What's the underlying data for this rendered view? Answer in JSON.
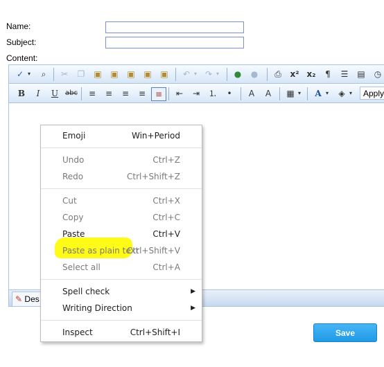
{
  "form": {
    "name_label": "Name:",
    "subject_label": "Subject:",
    "content_label": "Content:",
    "name_value": "",
    "subject_value": ""
  },
  "toolbar": {
    "apply_label": "Apply"
  },
  "design_tab": {
    "label": "Des"
  },
  "context_menu": {
    "emoji": {
      "label": "Emoji",
      "shortcut": "Win+Period"
    },
    "undo": {
      "label": "Undo",
      "shortcut": "Ctrl+Z"
    },
    "redo": {
      "label": "Redo",
      "shortcut": "Ctrl+Shift+Z"
    },
    "cut": {
      "label": "Cut",
      "shortcut": "Ctrl+X"
    },
    "copy": {
      "label": "Copy",
      "shortcut": "Ctrl+C"
    },
    "paste": {
      "label": "Paste",
      "shortcut": "Ctrl+V"
    },
    "paste_plain": {
      "label": "Paste as plain text",
      "shortcut": "Ctrl+Shift+V"
    },
    "select_all": {
      "label": "Select all",
      "shortcut": "Ctrl+A"
    },
    "spell_check": {
      "label": "Spell check"
    },
    "writing_direction": {
      "label": "Writing Direction"
    },
    "inspect": {
      "label": "Inspect",
      "shortcut": "Ctrl+Shift+I"
    }
  },
  "save_button": {
    "label": "Save"
  },
  "colors": {
    "highlight": "#fffa0a",
    "save": "#2aa3ee",
    "editor_border": "#a9c3e1"
  }
}
